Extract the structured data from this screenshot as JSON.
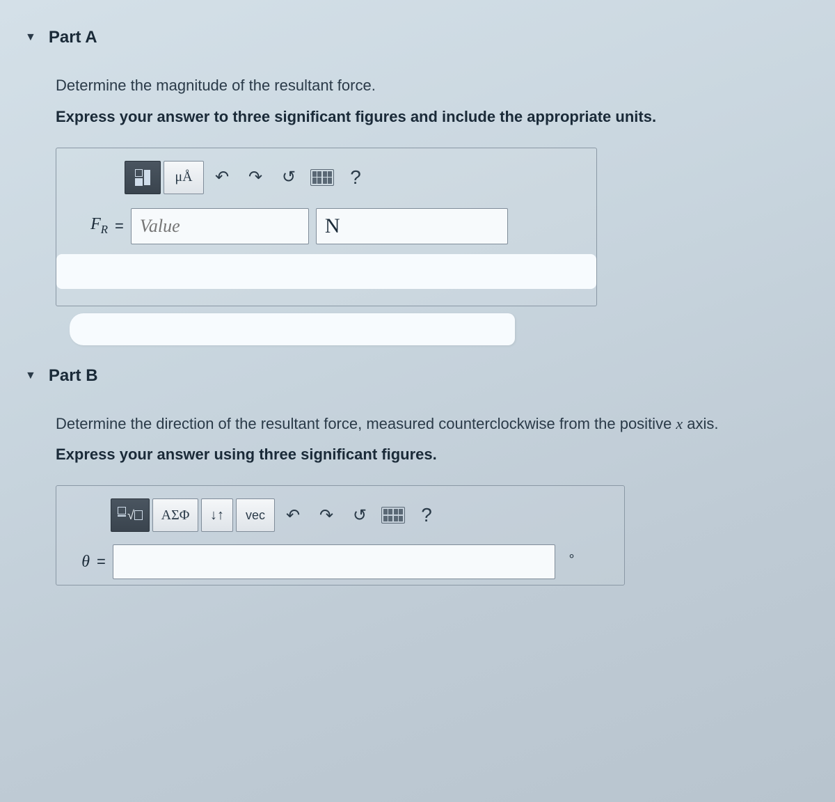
{
  "partA": {
    "title": "Part A",
    "instruction": "Determine the magnitude of the resultant force.",
    "instruction_bold": "Express your answer to three significant figures and include the appropriate units.",
    "toolbar": {
      "units_btn": "μÅ",
      "undo": "↶",
      "redo": "↷",
      "reset": "↺",
      "help": "?"
    },
    "var_html": "F<sub>R</sub>",
    "eq": "=",
    "value_placeholder": "Value",
    "units_value": "N"
  },
  "partB": {
    "title": "Part B",
    "instruction_pre": "Determine the direction of the resultant force, measured counterclockwise from the positive ",
    "instruction_x": "x",
    "instruction_post": " axis.",
    "instruction_bold": "Express your answer using three significant figures.",
    "toolbar": {
      "greek_btn": "ΑΣΦ",
      "subsup": "↓↑",
      "vec": "vec",
      "undo": "↶",
      "redo": "↷",
      "reset": "↺",
      "help": "?"
    },
    "var": "θ",
    "eq": "=",
    "deg": "∘"
  }
}
